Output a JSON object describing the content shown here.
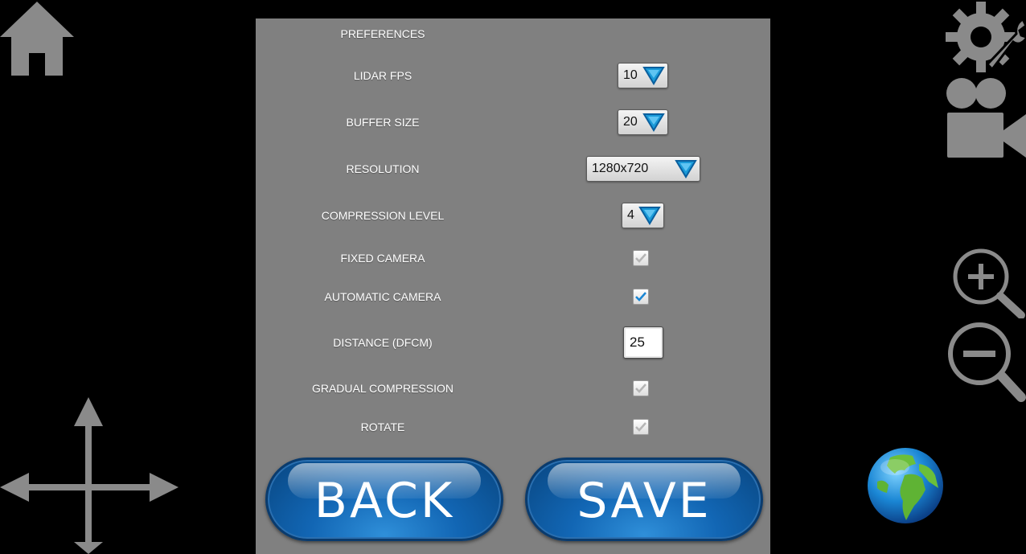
{
  "panel": {
    "title": "PREFERENCES",
    "lidar_fps": {
      "label": "LIDAR FPS",
      "value": "10"
    },
    "buffer_size": {
      "label": "BUFFER SIZE",
      "value": "20"
    },
    "resolution": {
      "label": "RESOLUTION",
      "value": "1280x720"
    },
    "compression_level": {
      "label": "COMPRESSION LEVEL",
      "value": "4"
    },
    "fixed_camera": {
      "label": "FIXED CAMERA",
      "checked": false
    },
    "automatic_camera": {
      "label": "AUTOMATIC CAMERA",
      "checked": true
    },
    "distance": {
      "label": "DISTANCE (DFCM)",
      "value": "25"
    },
    "gradual_compression": {
      "label": "GRADUAL COMPRESSION",
      "checked": false
    },
    "rotate": {
      "label": "ROTATE",
      "checked": false
    }
  },
  "buttons": {
    "back": "BACK",
    "save": "SAVE"
  },
  "icons": [
    "home-icon",
    "settings-icon",
    "camera-icon",
    "zoom-in-icon",
    "zoom-out-icon",
    "move-icon",
    "globe-icon"
  ],
  "colors": {
    "panel_bg": "#808080",
    "icon_gray": "#8a8a8a",
    "button_blue": "#1266b4",
    "arrow_blue": "#1a9ad8"
  }
}
